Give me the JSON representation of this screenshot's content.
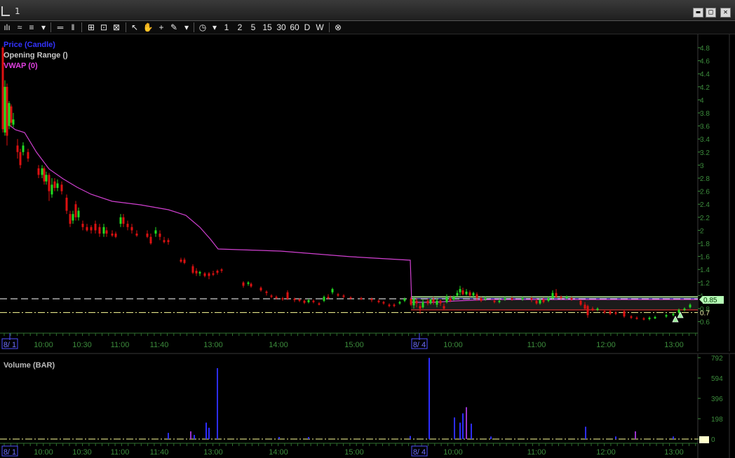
{
  "window": {
    "title": "1"
  },
  "toolbar": {
    "interval_buttons": [
      "1",
      "2",
      "5",
      "15",
      "30",
      "60",
      "D",
      "W"
    ]
  },
  "price_panel": {
    "legends": [
      {
        "label": "Price (Candle)",
        "color": "#3333ff"
      },
      {
        "label": "Opening Range ()",
        "color": "#c8c8c8"
      },
      {
        "label": "VWAP (0)",
        "color": "#e040e0"
      }
    ],
    "price_axis_ticks": [
      "4.8",
      "4.6",
      "4.4",
      "4.2",
      "4",
      "3.8",
      "3.6",
      "3.4",
      "3.2",
      "3",
      "2.8",
      "2.6",
      "2.4",
      "2.2",
      "2",
      "1.8",
      "1.6",
      "1.4",
      "1.2",
      "1",
      "0.8",
      "0.6"
    ],
    "last_price_label": "0.85",
    "opening_range_label": "0.7"
  },
  "time_axis": {
    "labels": [
      "8/ 1",
      "10:00",
      "10:30",
      "11:00",
      "11:40",
      "13:00",
      "14:00",
      "15:00",
      "8/ 4",
      "10:00",
      "11:00",
      "12:00",
      "13:00"
    ]
  },
  "volume_panel": {
    "legend": "Volume (BAR)",
    "axis_ticks": [
      "792",
      "594",
      "396",
      "198",
      "0"
    ]
  },
  "colors": {
    "up": "#22dd22",
    "down": "#dd1111",
    "vwap": "#d040d0",
    "grid": "#2a4a2a",
    "axis_text": "#3c8c3c"
  }
}
